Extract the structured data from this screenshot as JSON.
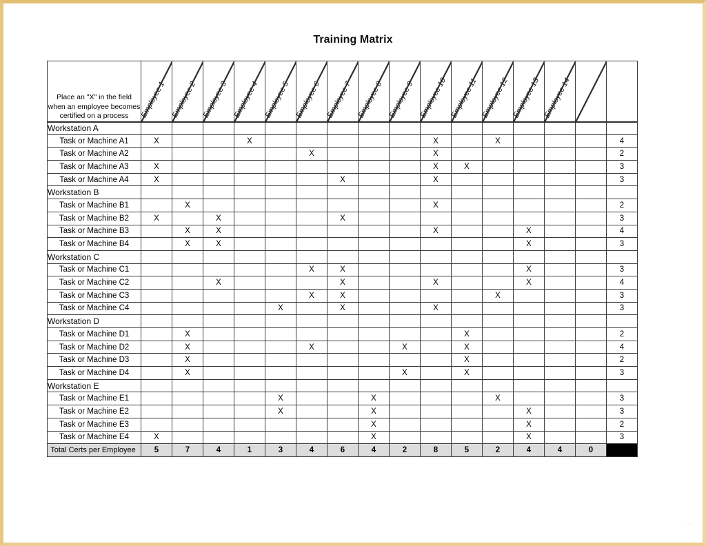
{
  "page": {
    "title": "Training Matrix",
    "border_color": "#e8c98a",
    "artifact": "..."
  },
  "table": {
    "instruction": "Place an \"X\" in the field when an employee becomes certified on a process",
    "employee_columns": [
      "Employee 1",
      "Employee 2",
      "Employee 3",
      "Employee 4",
      "Employee 5",
      "Employee 6",
      "Employee 7",
      "Employee 8",
      "Employee 9",
      "Employee 10",
      "Employee 11",
      "Employee 12",
      "Employee 13",
      "Employee 14"
    ],
    "blank_column_label": "",
    "totals_column_label": "",
    "mark": "X",
    "totals_row_label": "Total Certs per Employee",
    "totals_row_values": [
      5,
      7,
      4,
      1,
      3,
      4,
      6,
      4,
      2,
      8,
      5,
      2,
      4,
      4,
      0
    ],
    "colors": {
      "workstation_band": "#9a9a9a",
      "totals_cell": "#d5d5d5",
      "totals_row": "#dcdcdc",
      "grand_total_cell": "#000000",
      "grid_line": "#3a3a3a"
    },
    "groups": [
      {
        "name": "Workstation A",
        "rows": [
          {
            "label": "Task or Machine A1",
            "marks": [
              1,
              0,
              0,
              1,
              0,
              0,
              0,
              0,
              0,
              1,
              0,
              1,
              0,
              0
            ],
            "total": 4
          },
          {
            "label": "Task or Machine A2",
            "marks": [
              0,
              0,
              0,
              0,
              0,
              1,
              0,
              0,
              0,
              1,
              0,
              0,
              0,
              0
            ],
            "total": 2
          },
          {
            "label": "Task or Machine A3",
            "marks": [
              1,
              0,
              0,
              0,
              0,
              0,
              0,
              0,
              0,
              1,
              1,
              0,
              0,
              0
            ],
            "total": 3
          },
          {
            "label": "Task or Machine A4",
            "marks": [
              1,
              0,
              0,
              0,
              0,
              0,
              1,
              0,
              0,
              1,
              0,
              0,
              0,
              0
            ],
            "total": 3
          }
        ]
      },
      {
        "name": "Workstation B",
        "rows": [
          {
            "label": "Task or Machine B1",
            "marks": [
              0,
              1,
              0,
              0,
              0,
              0,
              0,
              0,
              0,
              1,
              0,
              0,
              0,
              0
            ],
            "total": 2
          },
          {
            "label": "Task or Machine B2",
            "marks": [
              1,
              0,
              1,
              0,
              0,
              0,
              1,
              0,
              0,
              0,
              0,
              0,
              0,
              0
            ],
            "total": 3
          },
          {
            "label": "Task or Machine B3",
            "marks": [
              0,
              1,
              1,
              0,
              0,
              0,
              0,
              0,
              0,
              1,
              0,
              0,
              1,
              0
            ],
            "total": 4
          },
          {
            "label": "Task or Machine B4",
            "marks": [
              0,
              1,
              1,
              0,
              0,
              0,
              0,
              0,
              0,
              0,
              0,
              0,
              1,
              0
            ],
            "total": 3
          }
        ]
      },
      {
        "name": "Workstation C",
        "rows": [
          {
            "label": "Task or Machine C1",
            "marks": [
              0,
              0,
              0,
              0,
              0,
              1,
              1,
              0,
              0,
              0,
              0,
              0,
              1,
              0
            ],
            "total": 3
          },
          {
            "label": "Task or Machine C2",
            "marks": [
              0,
              0,
              1,
              0,
              0,
              0,
              1,
              0,
              0,
              1,
              0,
              0,
              1,
              0
            ],
            "total": 4
          },
          {
            "label": "Task or Machine C3",
            "marks": [
              0,
              0,
              0,
              0,
              0,
              1,
              1,
              0,
              0,
              0,
              0,
              1,
              0,
              0
            ],
            "total": 3
          },
          {
            "label": "Task or Machine C4",
            "marks": [
              0,
              0,
              0,
              0,
              1,
              0,
              1,
              0,
              0,
              1,
              0,
              0,
              0,
              0
            ],
            "total": 3
          }
        ]
      },
      {
        "name": "Workstation D",
        "rows": [
          {
            "label": "Task or Machine D1",
            "marks": [
              0,
              1,
              0,
              0,
              0,
              0,
              0,
              0,
              0,
              0,
              1,
              0,
              0,
              0
            ],
            "total": 2
          },
          {
            "label": "Task or Machine D2",
            "marks": [
              0,
              1,
              0,
              0,
              0,
              1,
              0,
              0,
              1,
              0,
              1,
              0,
              0,
              0
            ],
            "total": 4
          },
          {
            "label": "Task or Machine D3",
            "marks": [
              0,
              1,
              0,
              0,
              0,
              0,
              0,
              0,
              0,
              0,
              1,
              0,
              0,
              0
            ],
            "total": 2
          },
          {
            "label": "Task or Machine D4",
            "marks": [
              0,
              1,
              0,
              0,
              0,
              0,
              0,
              0,
              1,
              0,
              1,
              0,
              0,
              0
            ],
            "total": 3
          }
        ]
      },
      {
        "name": "Workstation E",
        "rows": [
          {
            "label": "Task or Machine E1",
            "marks": [
              0,
              0,
              0,
              0,
              1,
              0,
              0,
              1,
              0,
              0,
              0,
              1,
              0,
              0
            ],
            "total": 3
          },
          {
            "label": "Task or Machine E2",
            "marks": [
              0,
              0,
              0,
              0,
              1,
              0,
              0,
              1,
              0,
              0,
              0,
              0,
              1,
              0
            ],
            "total": 3
          },
          {
            "label": "Task or Machine E3",
            "marks": [
              0,
              0,
              0,
              0,
              0,
              0,
              0,
              1,
              0,
              0,
              0,
              0,
              1,
              0
            ],
            "total": 2
          },
          {
            "label": "Task or Machine E4",
            "marks": [
              1,
              0,
              0,
              0,
              0,
              0,
              0,
              1,
              0,
              0,
              0,
              0,
              1,
              0
            ],
            "total": 3
          }
        ]
      }
    ]
  }
}
